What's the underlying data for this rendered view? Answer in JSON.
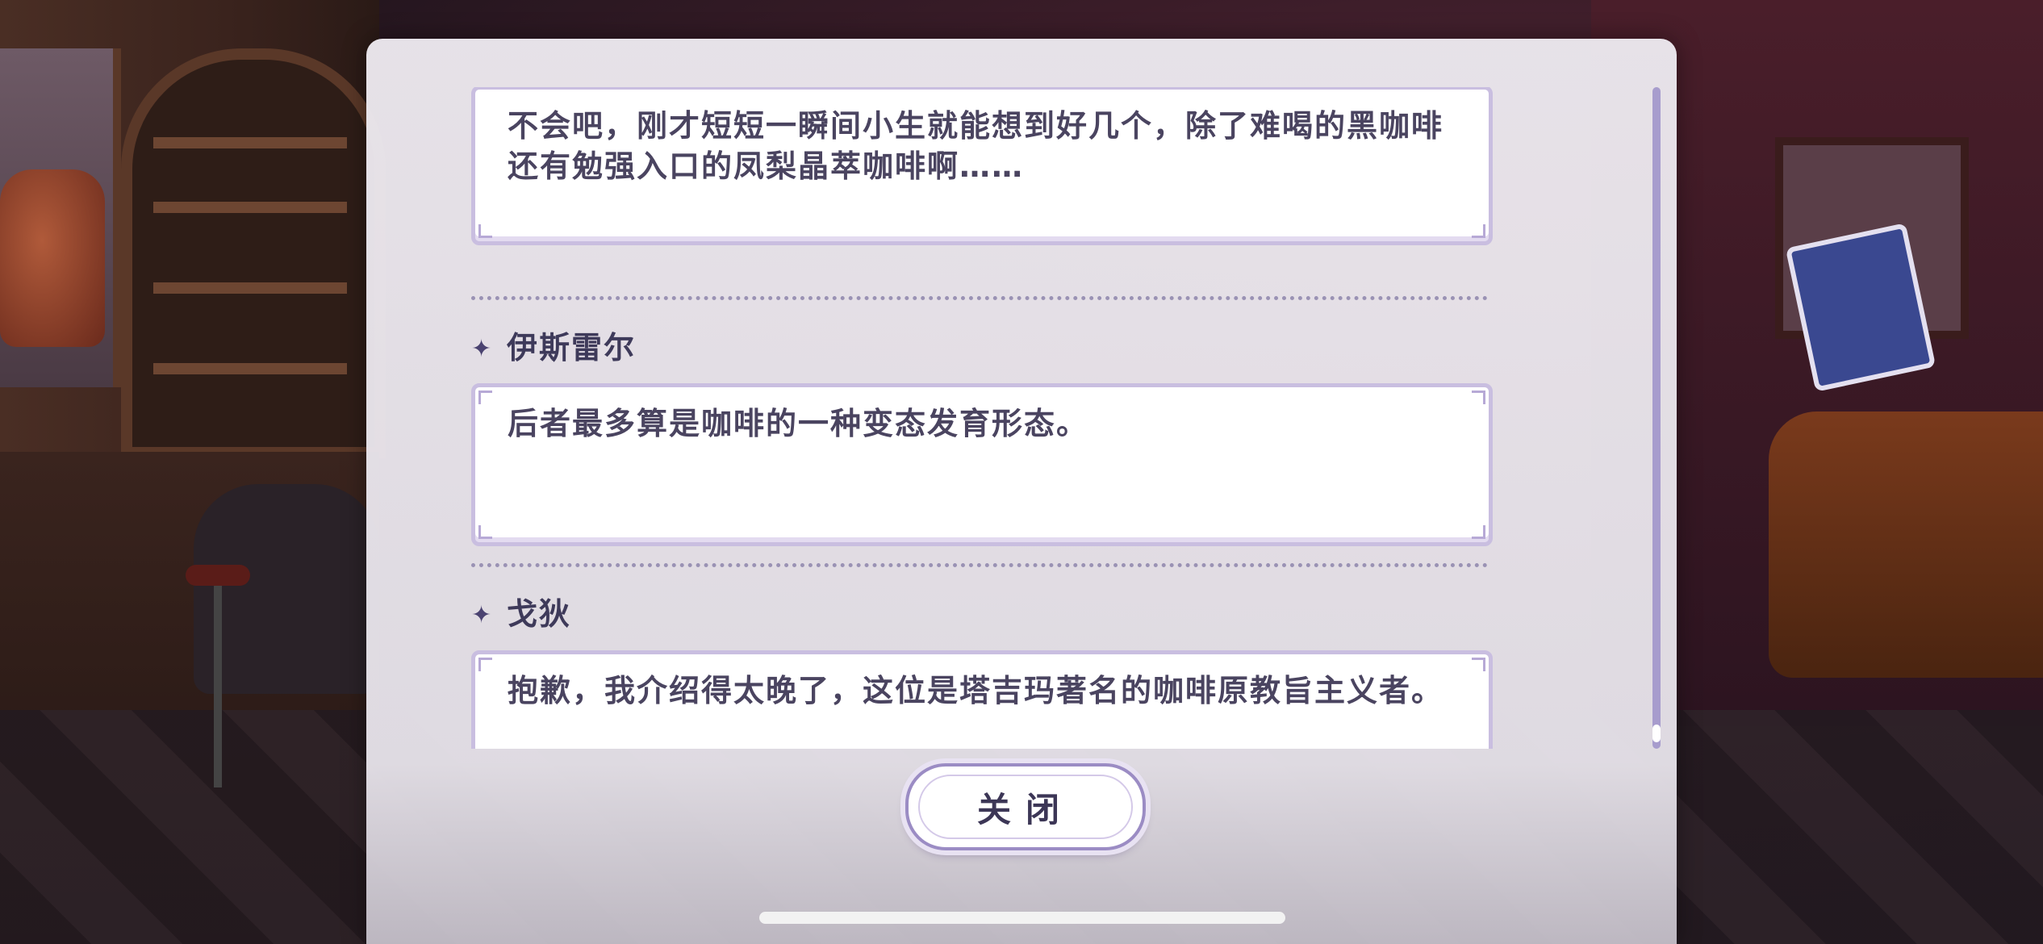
{
  "dialog_log": {
    "entries": [
      {
        "speaker": "",
        "text": "不会吧，刚才短短一瞬间小生就能想到好几个，除了难喝的黑咖啡还有勉强入口的凤梨晶萃咖啡啊……"
      },
      {
        "speaker": "伊斯雷尔",
        "text": "后者最多算是咖啡的一种变态发育形态。"
      },
      {
        "speaker": "戈狄",
        "text": "抱歉，我介绍得太晚了，这位是塔吉玛著名的咖啡原教旨主义者。"
      }
    ],
    "star_glyph": "✦"
  },
  "close_button": {
    "label": "关闭"
  },
  "colors": {
    "panel_bg": "#ece8ee",
    "bubble_border": "#c9bee0",
    "text": "#4a4460",
    "scrollbar": "#a79ccd"
  }
}
